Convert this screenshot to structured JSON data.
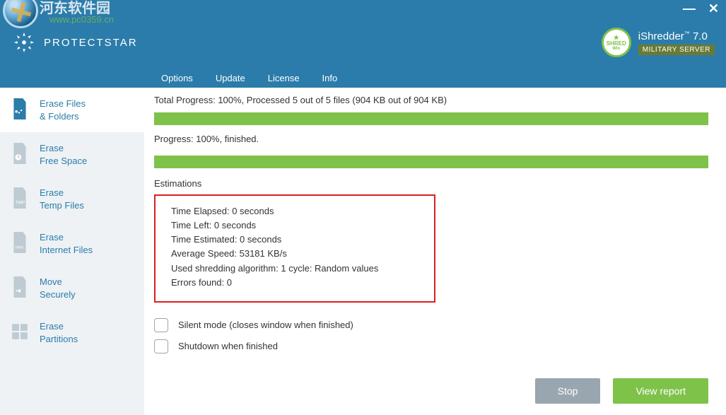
{
  "overlay": {
    "cn": "河东软件园",
    "url": "www.pc0359.cn"
  },
  "window": {
    "minimize": "—",
    "close": "✕"
  },
  "brand": {
    "name": "PROTECTSTAR"
  },
  "product": {
    "title_pre": "iShredder",
    "tm": "™",
    "version": " 7.0",
    "subtitle": "MILITARY SERVER",
    "badge_star": "★",
    "badge_t1": "SHRED",
    "badge_t2": "Win"
  },
  "menu": {
    "options": "Options",
    "update": "Update",
    "license": "License",
    "info": "Info"
  },
  "sidebar": {
    "items": [
      {
        "label": "Erase Files\n& Folders"
      },
      {
        "label": "Erase\nFree Space"
      },
      {
        "label": "Erase\nTemp Files"
      },
      {
        "label": "Erase\nInternet Files"
      },
      {
        "label": "Move\nSecurely"
      },
      {
        "label": "Erase\nPartitions"
      }
    ]
  },
  "main": {
    "total_line": "Total Progress: 100%, Processed 5 out of 5 files (904 KB out of 904 KB)",
    "progress_line": "Progress: 100%, finished.",
    "est_title": "Estimations",
    "est": {
      "elapsed": "Time Elapsed: 0 seconds",
      "left": "Time Left: 0 seconds",
      "estimated": "Time Estimated: 0 seconds",
      "speed": "Average Speed: 53181 KB/s",
      "algo": "Used shredding algorithm:   1 cycle: Random values",
      "errors": "Errors found: 0"
    },
    "silent": "Silent mode (closes window when finished)",
    "shutdown": "Shutdown when finished",
    "stop": "Stop",
    "report": "View report"
  }
}
